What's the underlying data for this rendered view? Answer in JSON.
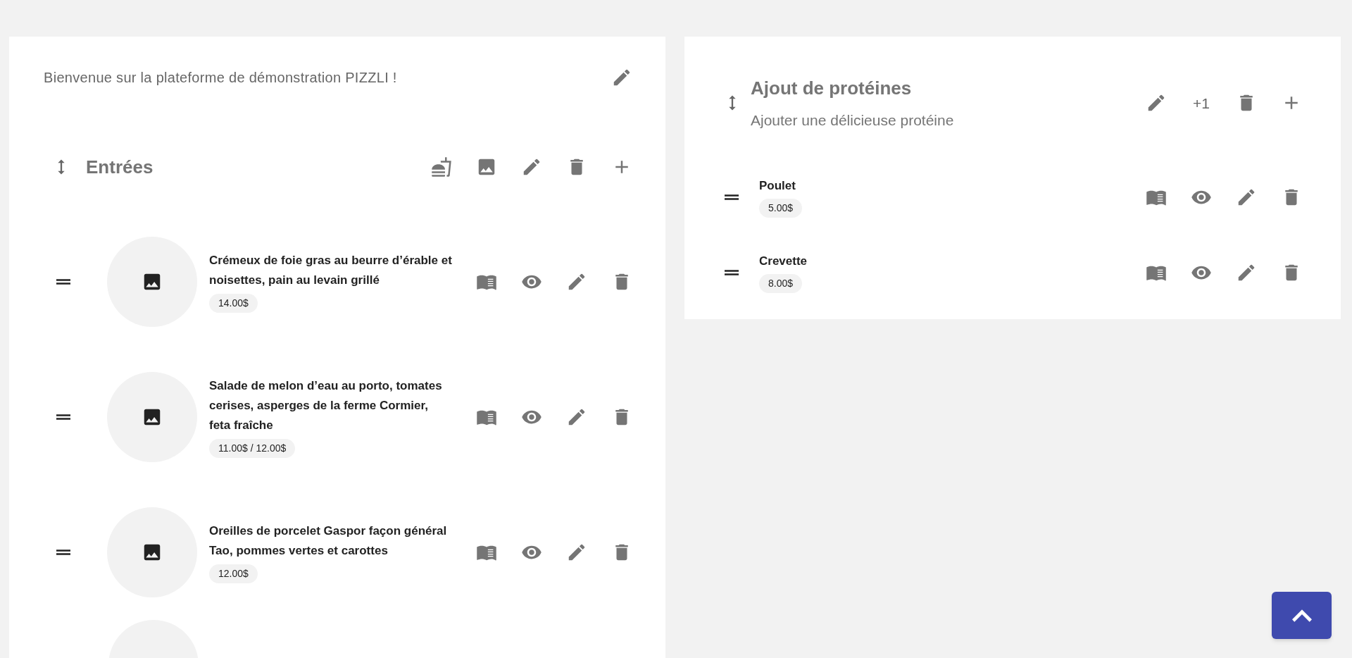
{
  "welcome": {
    "text": "Bienvenue sur la plateforme de démonstration PIZZLI !"
  },
  "category": {
    "title": "Entrées",
    "items": [
      {
        "name": "Crémeux de foie gras au beurre d’érable et noisettes, pain au levain grillé",
        "price": "14.00$"
      },
      {
        "name": "Salade de melon d’eau au porto, tomates cerises, asperges de la ferme Cormier, feta fraîche",
        "price": "11.00$ / 12.00$"
      },
      {
        "name": "Oreilles de porcelet Gaspor façon général Tao, pommes vertes et carottes",
        "price": "12.00$"
      }
    ]
  },
  "option_group": {
    "title": "Ajout de protéines",
    "subtitle": "Ajouter une délicieuse protéine",
    "increment_label": "+1",
    "items": [
      {
        "name": "Poulet",
        "price": "5.00$"
      },
      {
        "name": "Crevette",
        "price": "8.00$"
      }
    ]
  }
}
